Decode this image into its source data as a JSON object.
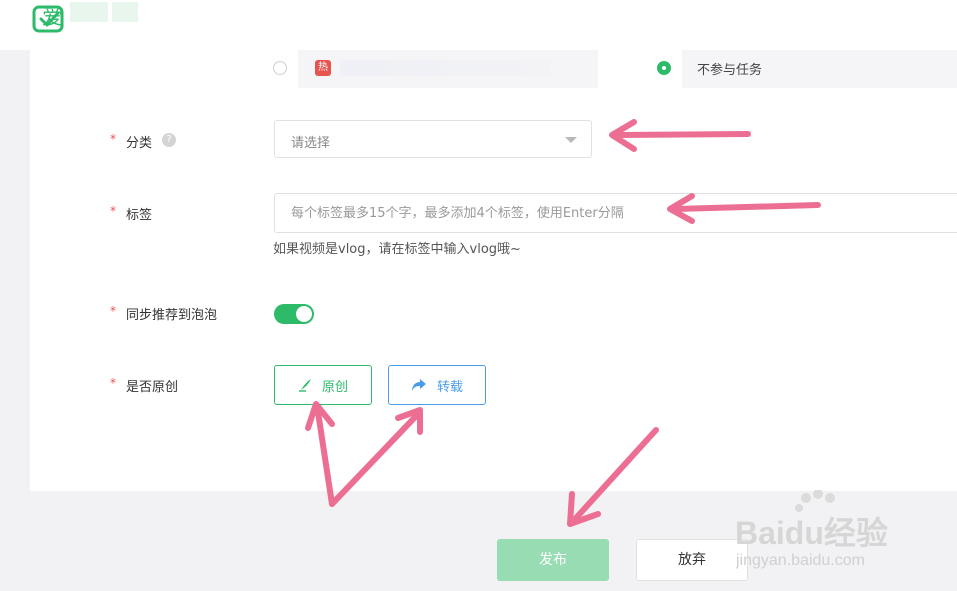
{
  "header": {
    "logo_text": "爱"
  },
  "task_options": {
    "hot_badge": "热",
    "no_task_label": "不参与任务"
  },
  "form": {
    "category": {
      "label": "分类",
      "help": "?",
      "placeholder": "请选择"
    },
    "tags": {
      "label": "标签",
      "placeholder": "每个标签最多15个字，最多添加4个标签，使用Enter分隔",
      "hint": "如果视频是vlog，请在标签中输入vlog哦~"
    },
    "sync": {
      "label": "同步推荐到泡泡",
      "enabled": true
    },
    "original": {
      "label": "是否原创",
      "original_button": "原创",
      "repost_button": "转载"
    },
    "required_mark": "*"
  },
  "actions": {
    "publish": "发布",
    "abandon": "放弃"
  },
  "watermark": {
    "brand": "Baidu经验",
    "url": "jingyan.baidu.com"
  },
  "colors": {
    "brand_green": "#2dbb6a",
    "arrow_pink": "#ec6e93",
    "repost_blue": "#4b9ce8"
  }
}
